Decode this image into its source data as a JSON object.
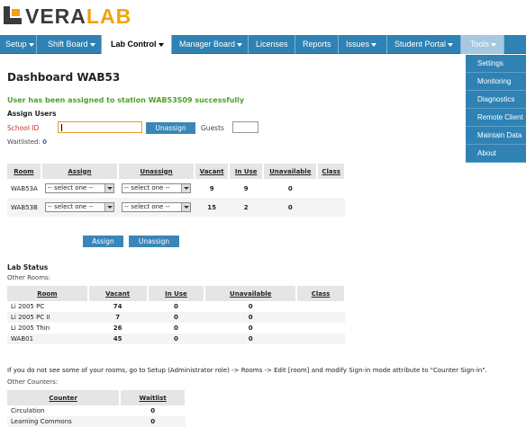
{
  "brand": {
    "part1": "VERA",
    "part2": "LAB"
  },
  "nav": {
    "items": [
      {
        "label": "Setup"
      },
      {
        "label": "Shift Board"
      },
      {
        "label": "Lab Control"
      },
      {
        "label": "Manager Board"
      },
      {
        "label": "Licenses"
      },
      {
        "label": "Reports"
      },
      {
        "label": "Issues"
      },
      {
        "label": "Student Portal"
      },
      {
        "label": "Tools"
      }
    ]
  },
  "tools_menu": [
    "Settings",
    "Monitoring",
    "Diagnostics",
    "Remote Client",
    "Maintain Data",
    "About"
  ],
  "page": {
    "title": "Dashboard WAB53",
    "success_message": "User has been assigned to station WAB53S09 successfully"
  },
  "assign_users": {
    "title": "Assign Users",
    "school_id_label": "School ID",
    "school_id_value": "",
    "unassign_button": "Unassign",
    "guests_label": "Guests",
    "guests_value": "",
    "waitlisted_label": "Waitlisted:",
    "waitlisted_value": "0"
  },
  "rooms_table": {
    "headers": [
      "Room",
      "Assign",
      "Unassign",
      "Vacant",
      "In Use",
      "Unavailable",
      "Class"
    ],
    "select_placeholder": "-- select one --",
    "rows": [
      {
        "room": "WAB53A",
        "vacant": "9",
        "in_use": "9",
        "unavailable": "0",
        "class": ""
      },
      {
        "room": "WAB53B",
        "vacant": "15",
        "in_use": "2",
        "unavailable": "0",
        "class": ""
      }
    ],
    "assign_button": "Assign",
    "unassign_button": "Unassign"
  },
  "lab_status": {
    "title": "Lab Status",
    "other_rooms_label": "Other Rooms:",
    "headers": [
      "Room",
      "Vacant",
      "In Use",
      "Unavailable",
      "Class"
    ],
    "rows": [
      {
        "room": "Li 2005 PC",
        "vacant": "74",
        "in_use": "0",
        "unavailable": "0",
        "class": ""
      },
      {
        "room": "Li 2005 PC II",
        "vacant": "7",
        "in_use": "0",
        "unavailable": "0",
        "class": ""
      },
      {
        "room": "Li 2005 Thin",
        "vacant": "26",
        "in_use": "0",
        "unavailable": "0",
        "class": ""
      },
      {
        "room": "WAB01",
        "vacant": "45",
        "in_use": "0",
        "unavailable": "0",
        "class": ""
      }
    ]
  },
  "info_text": "If you do not see some of your rooms, go to Setup (Administrator role) -> Rooms -> Edit [room] and modify Sign-in mode attribute to \"Counter Sign-in\".",
  "counters": {
    "label": "Other Counters:",
    "headers": [
      "Counter",
      "Waitlist"
    ],
    "rows": [
      {
        "counter": "Circulation",
        "waitlist": "0"
      },
      {
        "counter": "Learning Commons",
        "waitlist": "0"
      }
    ]
  },
  "colors": {
    "nav": "#2f82b3",
    "accent": "#f2a30f",
    "success": "#4ea128",
    "alert": "#c0392b",
    "link": "#2a6fc0"
  }
}
